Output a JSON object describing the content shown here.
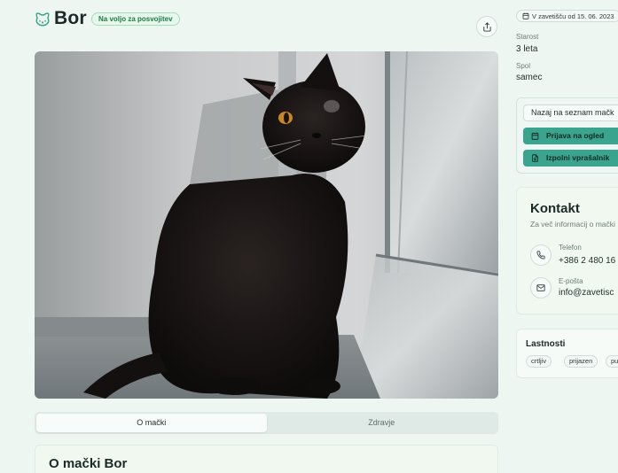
{
  "header": {
    "name": "Bor",
    "status_badge": "Na voljo za posvojitev"
  },
  "tabs": [
    {
      "label": "O mački",
      "active": true
    },
    {
      "label": "Zdravje",
      "active": false
    }
  ],
  "about": {
    "title": "O mački Bor"
  },
  "sidebar": {
    "shelter_date": "V zavetišču od 15. 06. 2023",
    "age_label": "Starost",
    "age_value": "3 leta",
    "sex_label": "Spol",
    "sex_value": "samec",
    "back_button": "Nazaj na seznam mačk",
    "visit_button": "Prijava na ogled",
    "form_button": "Izpolni vprašalnik",
    "contact": {
      "title": "Kontakt",
      "subtitle": "Za več informacij o mački",
      "phone_label": "Telefon",
      "phone_value": "+386 2 480 16",
      "email_label": "E-pošta",
      "email_value": "info@zavetisc"
    },
    "traits": {
      "title": "Lastnosti",
      "items": [
        "crtljiv",
        "prijazen",
        "pu"
      ]
    }
  },
  "colors": {
    "background": "#eef6f2",
    "accent": "#3aa48e",
    "badge_green": "#1f7a46"
  }
}
